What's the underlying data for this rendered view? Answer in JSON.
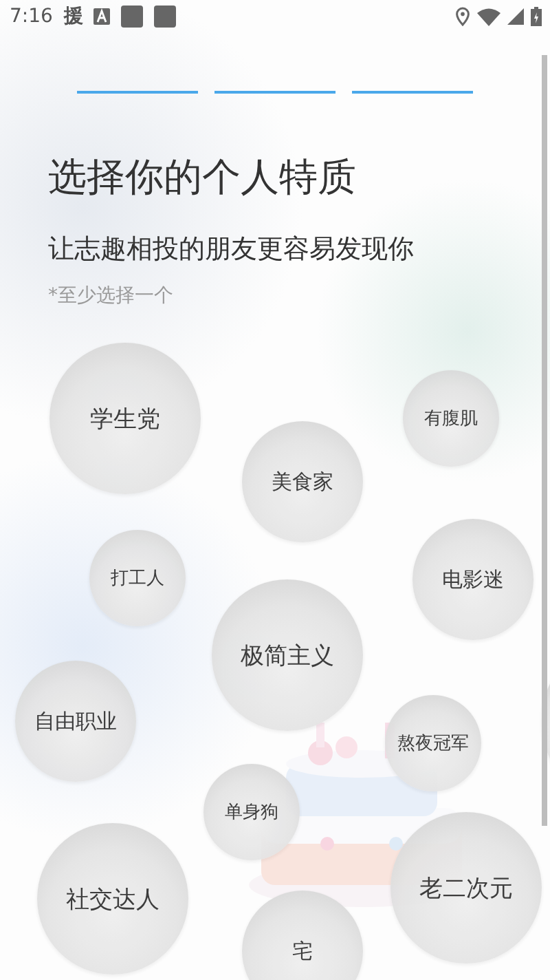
{
  "status_bar": {
    "time": "7:16",
    "app_glyph": "援"
  },
  "progress_steps": [
    {
      "done": true
    },
    {
      "done": true
    },
    {
      "done": true
    }
  ],
  "title": "选择你的个人特质",
  "subtitle": "让志趣相投的朋友更容易发现你",
  "hint": "*至少选择一个",
  "traits": [
    {
      "label": "学生党",
      "selected": false
    },
    {
      "label": "有腹肌",
      "selected": false
    },
    {
      "label": "美食家",
      "selected": false
    },
    {
      "label": "打工人",
      "selected": false
    },
    {
      "label": "电影迷",
      "selected": false
    },
    {
      "label": "极简主义",
      "selected": false
    },
    {
      "label": "自由职业",
      "selected": false
    },
    {
      "label": "熬夜冠军",
      "selected": false
    },
    {
      "label": "单身狗",
      "selected": false
    },
    {
      "label": "社交达人",
      "selected": false
    },
    {
      "label": "老二次元",
      "selected": false
    },
    {
      "label": "宅",
      "selected": false
    }
  ]
}
